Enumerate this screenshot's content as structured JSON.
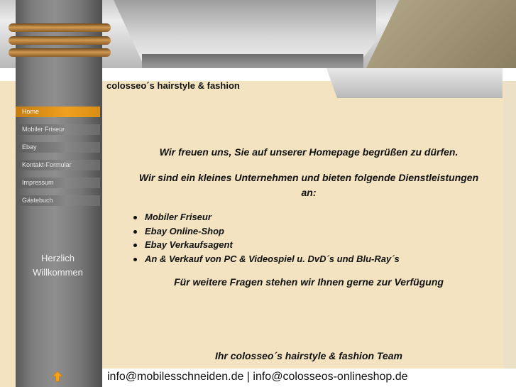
{
  "site": {
    "title": "colosseo´s hairstyle & fashion"
  },
  "nav": [
    {
      "label": "Home",
      "active": true
    },
    {
      "label": "Mobiler Friseur",
      "active": false
    },
    {
      "label": "Ebay",
      "active": false
    },
    {
      "label": "Kontakt-Formular",
      "active": false
    },
    {
      "label": "Impressum",
      "active": false
    },
    {
      "label": "Gästebuch",
      "active": false
    }
  ],
  "sidebar": {
    "welcome_line1": "Herzlich",
    "welcome_line2": "Willkommen",
    "scroll_icon": "up-arrow-icon"
  },
  "main": {
    "greeting": "Wir freuen uns, Sie auf unserer Homepage begrüßen zu dürfen.",
    "intro_line1": "Wir sind ein kleines Unternehmen und bieten folgende Dienstleistungen",
    "intro_line2": "an:",
    "services": [
      "Mobiler Friseur",
      "Ebay Online-Shop",
      "Ebay Verkaufsagent",
      "An & Verkauf von PC & Videospiel u. DvD´s und Blu-Ray´s"
    ],
    "questions": "Für weitere Fragen stehen wir Ihnen gerne zur Verfügung",
    "signature": "Ihr colosseo´s hairstyle & fashion Team"
  },
  "footer": {
    "contact": "info@mobilesschneiden.de | info@colosseos-onlineshop.de"
  },
  "colors": {
    "content_background": "#f3e3c0",
    "active_nav": "#f0a020",
    "sidebar_gray": "#7c7c7c",
    "accent_arrow": "#f5a21a"
  }
}
